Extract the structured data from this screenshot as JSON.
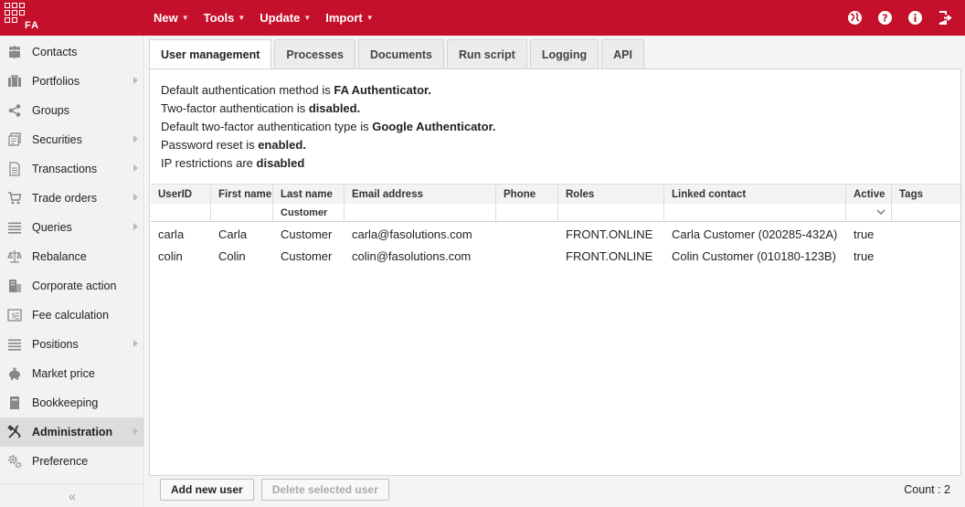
{
  "app": {
    "logo_text": "FA",
    "brand_color": "#c5102b"
  },
  "menu": [
    {
      "label": "New"
    },
    {
      "label": "Tools"
    },
    {
      "label": "Update"
    },
    {
      "label": "Import"
    }
  ],
  "top_icons": [
    "globe-icon",
    "help-icon",
    "info-icon",
    "logout-icon"
  ],
  "sidebar": {
    "items": [
      {
        "label": "Contacts",
        "icon": "contacts-icon",
        "submenu": false
      },
      {
        "label": "Portfolios",
        "icon": "briefcase-icon",
        "submenu": true
      },
      {
        "label": "Groups",
        "icon": "share-icon",
        "submenu": false
      },
      {
        "label": "Securities",
        "icon": "securities-icon",
        "submenu": true
      },
      {
        "label": "Transactions",
        "icon": "document-icon",
        "submenu": true
      },
      {
        "label": "Trade orders",
        "icon": "cart-icon",
        "submenu": true
      },
      {
        "label": "Queries",
        "icon": "list-icon",
        "submenu": true
      },
      {
        "label": "Rebalance",
        "icon": "scale-icon",
        "submenu": false
      },
      {
        "label": "Corporate action",
        "icon": "building-icon",
        "submenu": false
      },
      {
        "label": "Fee calculation",
        "icon": "fee-icon",
        "submenu": false
      },
      {
        "label": "Positions",
        "icon": "list-icon",
        "submenu": true
      },
      {
        "label": "Market price",
        "icon": "piggybank-icon",
        "submenu": false
      },
      {
        "label": "Bookkeeping",
        "icon": "book-icon",
        "submenu": false
      },
      {
        "label": "Administration",
        "icon": "tools-icon",
        "submenu": true,
        "active": true
      },
      {
        "label": "Preference",
        "icon": "gear-icon",
        "submenu": false
      }
    ],
    "collapse_label": "«"
  },
  "tabs": [
    {
      "label": "User management",
      "active": true
    },
    {
      "label": "Processes"
    },
    {
      "label": "Documents"
    },
    {
      "label": "Run script"
    },
    {
      "label": "Logging"
    },
    {
      "label": "API"
    }
  ],
  "info": {
    "line1_prefix": "Default authentication method is ",
    "line1_value": "FA Authenticator.",
    "line2_prefix": "Two-factor authentication is ",
    "line2_value": "disabled.",
    "line3_prefix": "Default two-factor authentication type is ",
    "line3_value": "Google Authenticator.",
    "line4_prefix": "Password reset is ",
    "line4_value": "enabled.",
    "line5_prefix": "IP restrictions are ",
    "line5_value": "disabled"
  },
  "table": {
    "columns": [
      "UserID",
      "First name",
      "Last name",
      "Email address",
      "Phone",
      "Roles",
      "Linked contact",
      "Active",
      "Tags"
    ],
    "filters": {
      "last_name": "Customer"
    },
    "rows": [
      {
        "userid": "carla",
        "first": "Carla",
        "last": "Customer",
        "email": "carla@fasolutions.com",
        "phone": "",
        "roles": "FRONT.ONLINE",
        "contact": "Carla Customer (020285-432A)",
        "active": "true",
        "tags": ""
      },
      {
        "userid": "colin",
        "first": "Colin",
        "last": "Customer",
        "email": "colin@fasolutions.com",
        "phone": "",
        "roles": "FRONT.ONLINE",
        "contact": "Colin Customer (010180-123B)",
        "active": "true",
        "tags": ""
      }
    ]
  },
  "footer": {
    "add_label": "Add new user",
    "delete_label": "Delete selected user",
    "count_label": "Count : 2"
  }
}
